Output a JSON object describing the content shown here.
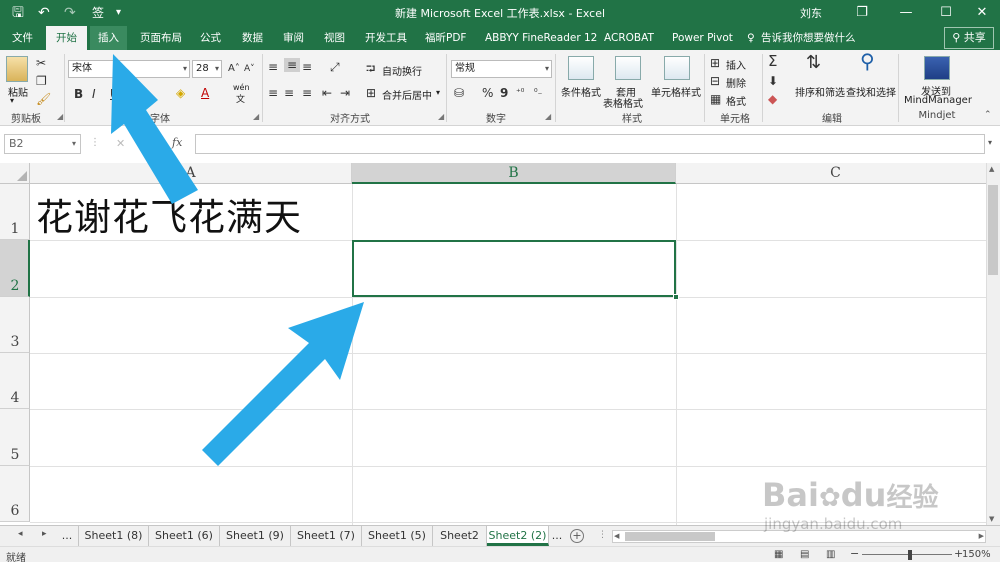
{
  "titlebar": {
    "quick_access": {
      "save": "🖫",
      "undo": "↶",
      "redo": "↷",
      "custom": "签",
      "more": "▾"
    },
    "title": "新建 Microsoft Excel 工作表.xlsx  -  Excel",
    "user": "刘东",
    "restore": "❐",
    "minimize": "—",
    "maximize": "☐",
    "close": "✕"
  },
  "tabs": [
    "文件",
    "开始",
    "插入",
    "页面布局",
    "公式",
    "数据",
    "审阅",
    "视图",
    "开发工具",
    "福昕PDF",
    "ABBYY FineReader 12",
    "ACROBAT",
    "Power Pivot"
  ],
  "tell_me": "告诉我你想要做什么",
  "share": "共享",
  "ribbon": {
    "clipboard": {
      "paste": "粘贴",
      "label": "剪贴板"
    },
    "font": {
      "name": "宋体",
      "size": "28",
      "bold": "B",
      "italic": "I",
      "underline": "U",
      "grow": "A˄",
      "shrink": "A˅",
      "wen": "wén",
      "wen_sub": "文",
      "label": "字体"
    },
    "align": {
      "wrap": "自动换行",
      "merge": "合并后居中",
      "label": "对齐方式"
    },
    "number": {
      "format": "常规",
      "percent": "%",
      "comma": "9",
      "label": "数字"
    },
    "styles": {
      "cond": "条件格式",
      "table1": "套用",
      "table2": "表格格式",
      "cell": "单元格样式",
      "label": "样式"
    },
    "cells": {
      "insert": "插入",
      "delete": "删除",
      "format": "格式",
      "label": "单元格"
    },
    "editing": {
      "sort": "排序和筛选",
      "find": "查找和选择",
      "label": "编辑"
    },
    "mindjet": {
      "send1": "发送到",
      "send2": "MindManager",
      "label": "Mindjet"
    }
  },
  "formula_bar": {
    "name_box": "B2",
    "cancel": "✕",
    "enter": "✓",
    "fx": "fx",
    "value": ""
  },
  "grid": {
    "columns": [
      "A",
      "B",
      "C"
    ],
    "rows": [
      "1",
      "2",
      "3",
      "4",
      "5",
      "6"
    ],
    "selected_cell": "B2",
    "cell_A1": "花谢花飞花满天"
  },
  "sheets": {
    "prev": "◂",
    "next": "▸",
    "more_left": "...",
    "more_right": "...",
    "add": "+",
    "tabs": [
      "Sheet1 (8)",
      "Sheet1 (6)",
      "Sheet1 (9)",
      "Sheet1 (7)",
      "Sheet1 (5)",
      "Sheet2",
      "Sheet2 (2)"
    ],
    "active": "Sheet2 (2)"
  },
  "status": {
    "ready": "就绪",
    "zoom": "150%",
    "zoom_minus": "−",
    "zoom_plus": "+"
  },
  "watermark": {
    "brand": "Bai",
    "du": "du",
    "jingyan": "经验",
    "url": "jingyan.baidu.com"
  },
  "colors": {
    "excel_green": "#217346",
    "arrow_blue": "#2aaae8"
  }
}
